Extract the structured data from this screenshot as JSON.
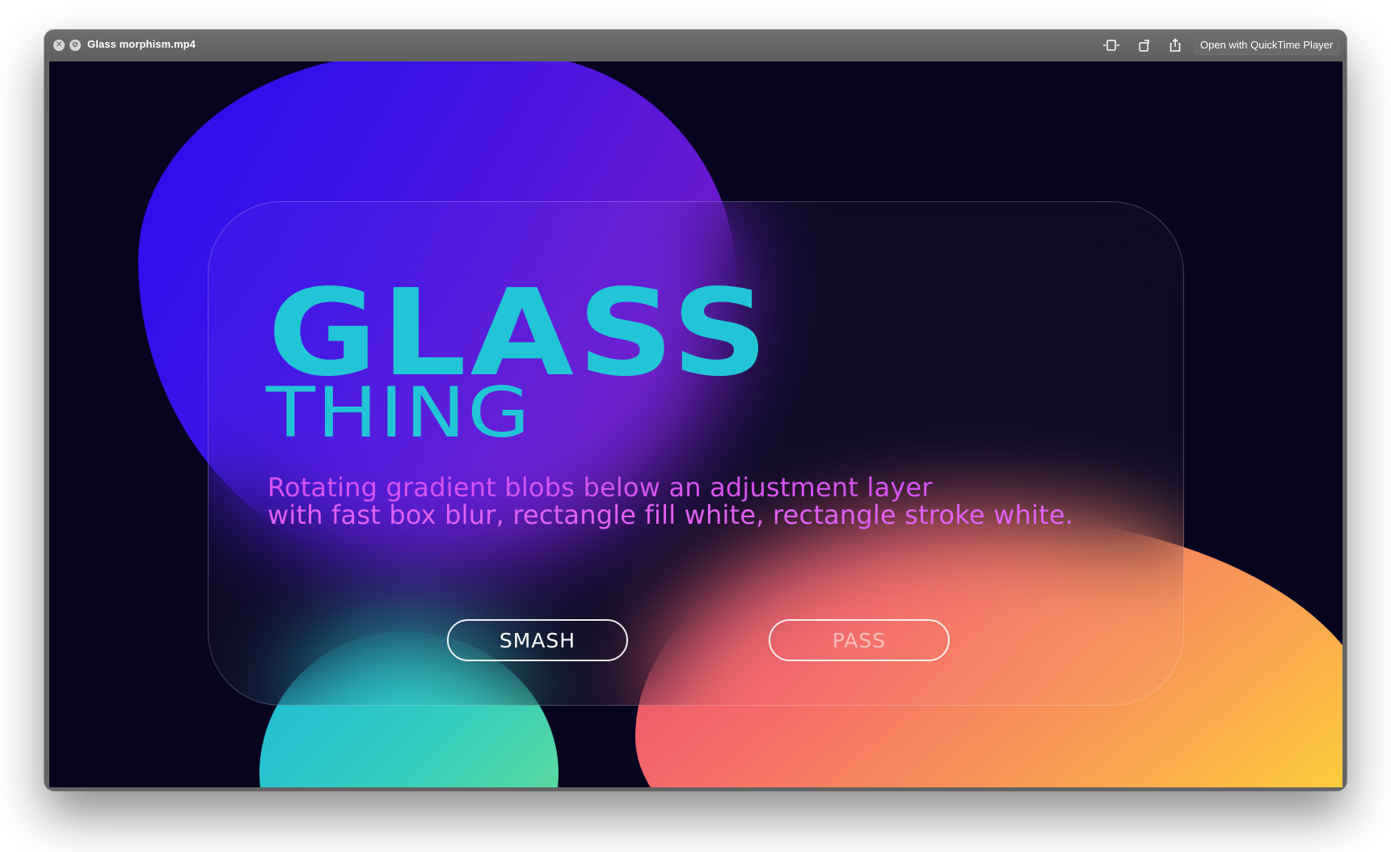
{
  "window": {
    "title": "Glass morphism.mp4",
    "open_with_label": "Open with QuickTime Player",
    "icons": {
      "close": "close-icon",
      "minimize": "minimize-icon",
      "trim": "trim-icon",
      "rotate": "rotate-icon",
      "share": "share-icon"
    }
  },
  "video": {
    "heading_primary": "GLASS",
    "heading_secondary": "THING",
    "description_line1": "Rotating gradient blobs below an adjustment layer",
    "description_line2": "with fast box blur, rectangle fill white, rectangle stroke white.",
    "buttons": {
      "smash_label": "SMASH",
      "pass_label": "PASS"
    },
    "colors": {
      "heading": "#22c5d6",
      "description": "#d653ef",
      "background": "#070420",
      "blob_purple": "#3d12e6",
      "blob_teal": "#34cdbf",
      "blob_orange": "#f99a55",
      "blob_yellow": "#fdf02a"
    }
  }
}
